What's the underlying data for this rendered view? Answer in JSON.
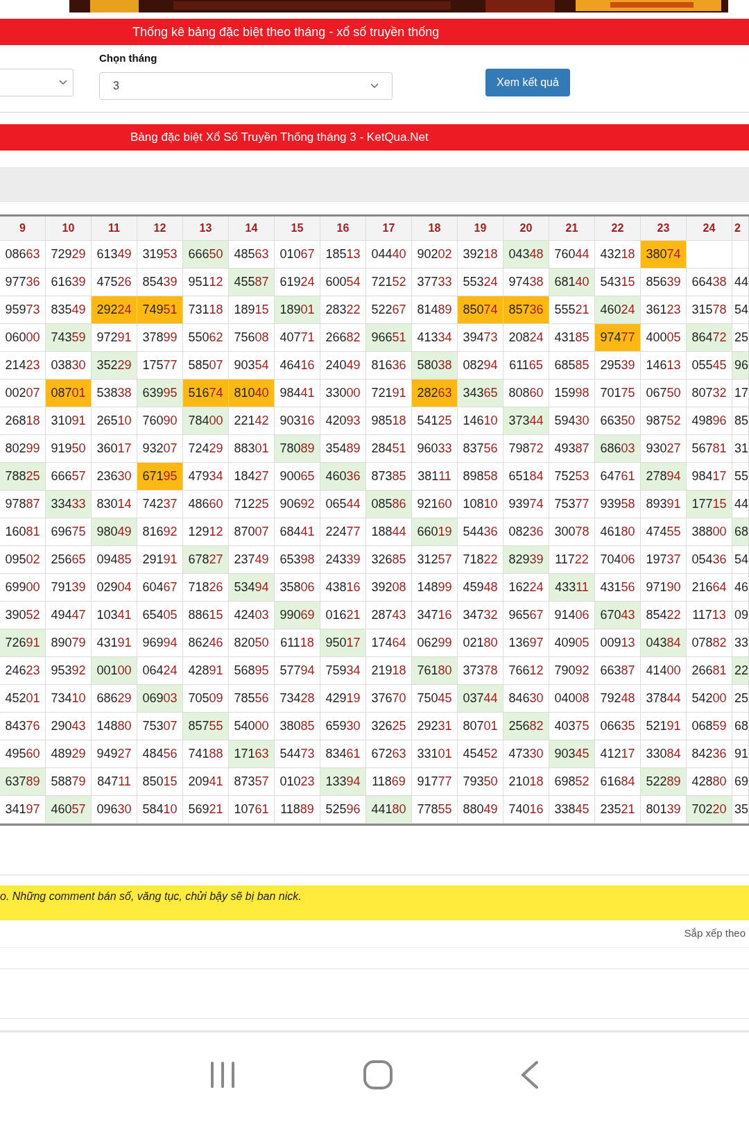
{
  "stats_bar": {
    "title": "Thống kê bảng đặc biệt theo tháng - xổ số truyền thống"
  },
  "filters": {
    "month_label": "Chọn tháng",
    "month_value": "3",
    "submit": "Xem kết quả"
  },
  "table_bar": {
    "title": "Bảng đặc biệt Xổ Số Truyền Thống tháng 3 - KetQua.Net"
  },
  "table": {
    "columns": [
      "9",
      "10",
      "11",
      "12",
      "13",
      "14",
      "15",
      "16",
      "17",
      "18",
      "19",
      "20",
      "21",
      "22",
      "23",
      "24",
      "2"
    ],
    "rows": [
      [
        {
          "text": "08663",
          "color": "#ffffff"
        },
        {
          "text": "72929",
          "color": "#ffffff"
        },
        {
          "text": "61349",
          "color": "#ffffff"
        },
        {
          "text": "31953",
          "color": "#ffffff"
        },
        {
          "text": "66650",
          "color": "#e2f2dc"
        },
        {
          "text": "48563",
          "color": "#ffffff"
        },
        {
          "text": "01067",
          "color": "#ffffff"
        },
        {
          "text": "18513",
          "color": "#ffffff"
        },
        {
          "text": "04440",
          "color": "#ffffff"
        },
        {
          "text": "90202",
          "color": "#ffffff"
        },
        {
          "text": "39218",
          "color": "#ffffff"
        },
        {
          "text": "04348",
          "color": "#e2f2dc"
        },
        {
          "text": "76044",
          "color": "#ffffff"
        },
        {
          "text": "43218",
          "color": "#ffffff"
        },
        {
          "text": "38074",
          "color": "#fdb813"
        }
      ],
      [
        {
          "text": "97736",
          "color": "#ffffff"
        },
        {
          "text": "61639",
          "color": "#ffffff"
        },
        {
          "text": "47526",
          "color": "#ffffff"
        },
        {
          "text": "85439",
          "color": "#ffffff"
        },
        {
          "text": "95112",
          "color": "#ffffff"
        },
        {
          "text": "45587",
          "color": "#e2f2dc"
        },
        {
          "text": "61924",
          "color": "#ffffff"
        },
        {
          "text": "60054",
          "color": "#ffffff"
        },
        {
          "text": "72152",
          "color": "#ffffff"
        },
        {
          "text": "37733",
          "color": "#ffffff"
        },
        {
          "text": "55324",
          "color": "#ffffff"
        },
        {
          "text": "97438",
          "color": "#ffffff"
        },
        {
          "text": "68140",
          "color": "#e2f2dc"
        },
        {
          "text": "54315",
          "color": "#ffffff"
        },
        {
          "text": "85639",
          "color": "#ffffff"
        },
        {
          "text": "66438",
          "color": "#ffffff"
        },
        {
          "text": "44",
          "color": "#ffffff"
        }
      ],
      [
        {
          "text": "95973",
          "color": "#ffffff"
        },
        {
          "text": "83549",
          "color": "#ffffff"
        },
        {
          "text": "29224",
          "color": "#fdb813"
        },
        {
          "text": "74951",
          "color": "#fdb813"
        },
        {
          "text": "73118",
          "color": "#ffffff"
        },
        {
          "text": "18915",
          "color": "#ffffff"
        },
        {
          "text": "18901",
          "color": "#e2f2dc"
        },
        {
          "text": "28322",
          "color": "#ffffff"
        },
        {
          "text": "52267",
          "color": "#ffffff"
        },
        {
          "text": "81489",
          "color": "#ffffff"
        },
        {
          "text": "85074",
          "color": "#fdb813"
        },
        {
          "text": "85736",
          "color": "#fdb813"
        },
        {
          "text": "55521",
          "color": "#ffffff"
        },
        {
          "text": "46024",
          "color": "#e2f2dc"
        },
        {
          "text": "36123",
          "color": "#ffffff"
        },
        {
          "text": "31578",
          "color": "#ffffff"
        },
        {
          "text": "54",
          "color": "#ffffff"
        }
      ],
      [
        {
          "text": "06000",
          "color": "#ffffff"
        },
        {
          "text": "74359",
          "color": "#e2f2dc"
        },
        {
          "text": "97291",
          "color": "#ffffff"
        },
        {
          "text": "37899",
          "color": "#ffffff"
        },
        {
          "text": "55062",
          "color": "#ffffff"
        },
        {
          "text": "75608",
          "color": "#ffffff"
        },
        {
          "text": "40771",
          "color": "#ffffff"
        },
        {
          "text": "26682",
          "color": "#ffffff"
        },
        {
          "text": "96651",
          "color": "#e2f2dc"
        },
        {
          "text": "41334",
          "color": "#ffffff"
        },
        {
          "text": "39473",
          "color": "#ffffff"
        },
        {
          "text": "20824",
          "color": "#ffffff"
        },
        {
          "text": "43185",
          "color": "#ffffff"
        },
        {
          "text": "97477",
          "color": "#fdb813"
        },
        {
          "text": "40005",
          "color": "#ffffff"
        },
        {
          "text": "86472",
          "color": "#e2f2dc"
        },
        {
          "text": "25",
          "color": "#ffffff"
        }
      ],
      [
        {
          "text": "21423",
          "color": "#ffffff"
        },
        {
          "text": "03830",
          "color": "#ffffff"
        },
        {
          "text": "35229",
          "color": "#e2f2dc"
        },
        {
          "text": "17577",
          "color": "#ffffff"
        },
        {
          "text": "58507",
          "color": "#ffffff"
        },
        {
          "text": "90354",
          "color": "#ffffff"
        },
        {
          "text": "46416",
          "color": "#ffffff"
        },
        {
          "text": "24049",
          "color": "#ffffff"
        },
        {
          "text": "81636",
          "color": "#ffffff"
        },
        {
          "text": "58038",
          "color": "#e2f2dc"
        },
        {
          "text": "08294",
          "color": "#ffffff"
        },
        {
          "text": "61165",
          "color": "#ffffff"
        },
        {
          "text": "68585",
          "color": "#ffffff"
        },
        {
          "text": "29539",
          "color": "#ffffff"
        },
        {
          "text": "14613",
          "color": "#ffffff"
        },
        {
          "text": "05545",
          "color": "#ffffff"
        },
        {
          "text": "96",
          "color": "#e2f2dc"
        }
      ],
      [
        {
          "text": "00207",
          "color": "#ffffff"
        },
        {
          "text": "08701",
          "color": "#fdb813"
        },
        {
          "text": "53838",
          "color": "#ffffff"
        },
        {
          "text": "63995",
          "color": "#e2f2dc"
        },
        {
          "text": "51674",
          "color": "#fdb813"
        },
        {
          "text": "81040",
          "color": "#fdb813"
        },
        {
          "text": "98441",
          "color": "#ffffff"
        },
        {
          "text": "33000",
          "color": "#ffffff"
        },
        {
          "text": "72191",
          "color": "#ffffff"
        },
        {
          "text": "28263",
          "color": "#fdb813"
        },
        {
          "text": "34365",
          "color": "#e2f2dc"
        },
        {
          "text": "80860",
          "color": "#ffffff"
        },
        {
          "text": "15998",
          "color": "#ffffff"
        },
        {
          "text": "70175",
          "color": "#ffffff"
        },
        {
          "text": "06750",
          "color": "#ffffff"
        },
        {
          "text": "80732",
          "color": "#ffffff"
        },
        {
          "text": "17",
          "color": "#ffffff"
        }
      ],
      [
        {
          "text": "26818",
          "color": "#ffffff"
        },
        {
          "text": "31091",
          "color": "#ffffff"
        },
        {
          "text": "26510",
          "color": "#ffffff"
        },
        {
          "text": "76090",
          "color": "#ffffff"
        },
        {
          "text": "78400",
          "color": "#e2f2dc"
        },
        {
          "text": "22142",
          "color": "#ffffff"
        },
        {
          "text": "90316",
          "color": "#ffffff"
        },
        {
          "text": "42093",
          "color": "#ffffff"
        },
        {
          "text": "98518",
          "color": "#ffffff"
        },
        {
          "text": "54125",
          "color": "#ffffff"
        },
        {
          "text": "14610",
          "color": "#ffffff"
        },
        {
          "text": "37344",
          "color": "#e2f2dc"
        },
        {
          "text": "59430",
          "color": "#ffffff"
        },
        {
          "text": "66350",
          "color": "#ffffff"
        },
        {
          "text": "98752",
          "color": "#ffffff"
        },
        {
          "text": "49896",
          "color": "#ffffff"
        },
        {
          "text": "85",
          "color": "#ffffff"
        }
      ],
      [
        {
          "text": "80299",
          "color": "#ffffff"
        },
        {
          "text": "91950",
          "color": "#ffffff"
        },
        {
          "text": "36017",
          "color": "#ffffff"
        },
        {
          "text": "93207",
          "color": "#ffffff"
        },
        {
          "text": "72429",
          "color": "#ffffff"
        },
        {
          "text": "88301",
          "color": "#ffffff"
        },
        {
          "text": "78089",
          "color": "#e2f2dc"
        },
        {
          "text": "35489",
          "color": "#ffffff"
        },
        {
          "text": "28451",
          "color": "#ffffff"
        },
        {
          "text": "96033",
          "color": "#ffffff"
        },
        {
          "text": "83756",
          "color": "#ffffff"
        },
        {
          "text": "79872",
          "color": "#ffffff"
        },
        {
          "text": "49387",
          "color": "#ffffff"
        },
        {
          "text": "68603",
          "color": "#e2f2dc"
        },
        {
          "text": "93027",
          "color": "#ffffff"
        },
        {
          "text": "56781",
          "color": "#ffffff"
        },
        {
          "text": "31",
          "color": "#ffffff"
        }
      ],
      [
        {
          "text": "78825",
          "color": "#e2f2dc"
        },
        {
          "text": "66657",
          "color": "#ffffff"
        },
        {
          "text": "23630",
          "color": "#ffffff"
        },
        {
          "text": "67195",
          "color": "#fdb813"
        },
        {
          "text": "47934",
          "color": "#ffffff"
        },
        {
          "text": "18427",
          "color": "#ffffff"
        },
        {
          "text": "90065",
          "color": "#ffffff"
        },
        {
          "text": "46036",
          "color": "#e2f2dc"
        },
        {
          "text": "87385",
          "color": "#ffffff"
        },
        {
          "text": "38111",
          "color": "#ffffff"
        },
        {
          "text": "89858",
          "color": "#ffffff"
        },
        {
          "text": "65184",
          "color": "#ffffff"
        },
        {
          "text": "75253",
          "color": "#ffffff"
        },
        {
          "text": "64761",
          "color": "#ffffff"
        },
        {
          "text": "27894",
          "color": "#e2f2dc"
        },
        {
          "text": "98417",
          "color": "#ffffff"
        },
        {
          "text": "55",
          "color": "#ffffff"
        }
      ],
      [
        {
          "text": "97887",
          "color": "#ffffff"
        },
        {
          "text": "33433",
          "color": "#e2f2dc"
        },
        {
          "text": "83014",
          "color": "#ffffff"
        },
        {
          "text": "74237",
          "color": "#ffffff"
        },
        {
          "text": "48660",
          "color": "#ffffff"
        },
        {
          "text": "71225",
          "color": "#ffffff"
        },
        {
          "text": "90692",
          "color": "#ffffff"
        },
        {
          "text": "06544",
          "color": "#ffffff"
        },
        {
          "text": "08586",
          "color": "#e2f2dc"
        },
        {
          "text": "92160",
          "color": "#ffffff"
        },
        {
          "text": "10810",
          "color": "#ffffff"
        },
        {
          "text": "93974",
          "color": "#ffffff"
        },
        {
          "text": "75377",
          "color": "#ffffff"
        },
        {
          "text": "93958",
          "color": "#ffffff"
        },
        {
          "text": "89391",
          "color": "#ffffff"
        },
        {
          "text": "17715",
          "color": "#e2f2dc"
        },
        {
          "text": "44",
          "color": "#ffffff"
        }
      ],
      [
        {
          "text": "16081",
          "color": "#ffffff"
        },
        {
          "text": "69675",
          "color": "#ffffff"
        },
        {
          "text": "98049",
          "color": "#e2f2dc"
        },
        {
          "text": "81692",
          "color": "#ffffff"
        },
        {
          "text": "12912",
          "color": "#ffffff"
        },
        {
          "text": "87007",
          "color": "#ffffff"
        },
        {
          "text": "68441",
          "color": "#ffffff"
        },
        {
          "text": "22477",
          "color": "#ffffff"
        },
        {
          "text": "18844",
          "color": "#ffffff"
        },
        {
          "text": "66019",
          "color": "#e2f2dc"
        },
        {
          "text": "54436",
          "color": "#ffffff"
        },
        {
          "text": "08236",
          "color": "#ffffff"
        },
        {
          "text": "30078",
          "color": "#ffffff"
        },
        {
          "text": "46180",
          "color": "#ffffff"
        },
        {
          "text": "47455",
          "color": "#ffffff"
        },
        {
          "text": "38800",
          "color": "#ffffff"
        },
        {
          "text": "68",
          "color": "#e2f2dc"
        }
      ],
      [
        {
          "text": "09502",
          "color": "#ffffff"
        },
        {
          "text": "25665",
          "color": "#ffffff"
        },
        {
          "text": "09485",
          "color": "#ffffff"
        },
        {
          "text": "29191",
          "color": "#ffffff"
        },
        {
          "text": "67827",
          "color": "#e2f2dc"
        },
        {
          "text": "23749",
          "color": "#ffffff"
        },
        {
          "text": "65398",
          "color": "#ffffff"
        },
        {
          "text": "24339",
          "color": "#ffffff"
        },
        {
          "text": "32685",
          "color": "#ffffff"
        },
        {
          "text": "31257",
          "color": "#ffffff"
        },
        {
          "text": "71822",
          "color": "#ffffff"
        },
        {
          "text": "82939",
          "color": "#e2f2dc"
        },
        {
          "text": "11722",
          "color": "#ffffff"
        },
        {
          "text": "70406",
          "color": "#ffffff"
        },
        {
          "text": "19737",
          "color": "#ffffff"
        },
        {
          "text": "05436",
          "color": "#ffffff"
        },
        {
          "text": "54",
          "color": "#ffffff"
        }
      ],
      [
        {
          "text": "69900",
          "color": "#ffffff"
        },
        {
          "text": "79139",
          "color": "#ffffff"
        },
        {
          "text": "02904",
          "color": "#ffffff"
        },
        {
          "text": "60467",
          "color": "#ffffff"
        },
        {
          "text": "71826",
          "color": "#ffffff"
        },
        {
          "text": "53494",
          "color": "#e2f2dc"
        },
        {
          "text": "35806",
          "color": "#ffffff"
        },
        {
          "text": "43816",
          "color": "#ffffff"
        },
        {
          "text": "39208",
          "color": "#ffffff"
        },
        {
          "text": "14899",
          "color": "#ffffff"
        },
        {
          "text": "45948",
          "color": "#ffffff"
        },
        {
          "text": "16224",
          "color": "#ffffff"
        },
        {
          "text": "43311",
          "color": "#e2f2dc"
        },
        {
          "text": "43156",
          "color": "#ffffff"
        },
        {
          "text": "97190",
          "color": "#ffffff"
        },
        {
          "text": "21664",
          "color": "#ffffff"
        },
        {
          "text": "46",
          "color": "#ffffff"
        }
      ],
      [
        {
          "text": "39052",
          "color": "#ffffff"
        },
        {
          "text": "49447",
          "color": "#ffffff"
        },
        {
          "text": "10341",
          "color": "#ffffff"
        },
        {
          "text": "65405",
          "color": "#ffffff"
        },
        {
          "text": "88615",
          "color": "#ffffff"
        },
        {
          "text": "42403",
          "color": "#ffffff"
        },
        {
          "text": "99069",
          "color": "#e2f2dc"
        },
        {
          "text": "01621",
          "color": "#ffffff"
        },
        {
          "text": "28743",
          "color": "#ffffff"
        },
        {
          "text": "34716",
          "color": "#ffffff"
        },
        {
          "text": "34732",
          "color": "#ffffff"
        },
        {
          "text": "96567",
          "color": "#ffffff"
        },
        {
          "text": "91406",
          "color": "#ffffff"
        },
        {
          "text": "67043",
          "color": "#e2f2dc"
        },
        {
          "text": "85422",
          "color": "#ffffff"
        },
        {
          "text": "11713",
          "color": "#ffffff"
        },
        {
          "text": "09",
          "color": "#ffffff"
        }
      ],
      [
        {
          "text": "72691",
          "color": "#e2f2dc"
        },
        {
          "text": "89079",
          "color": "#ffffff"
        },
        {
          "text": "43191",
          "color": "#ffffff"
        },
        {
          "text": "96994",
          "color": "#ffffff"
        },
        {
          "text": "86246",
          "color": "#ffffff"
        },
        {
          "text": "82050",
          "color": "#ffffff"
        },
        {
          "text": "61118",
          "color": "#ffffff"
        },
        {
          "text": "95017",
          "color": "#e2f2dc"
        },
        {
          "text": "17464",
          "color": "#ffffff"
        },
        {
          "text": "06299",
          "color": "#ffffff"
        },
        {
          "text": "02180",
          "color": "#ffffff"
        },
        {
          "text": "13697",
          "color": "#ffffff"
        },
        {
          "text": "40905",
          "color": "#ffffff"
        },
        {
          "text": "00913",
          "color": "#ffffff"
        },
        {
          "text": "04384",
          "color": "#e2f2dc"
        },
        {
          "text": "07882",
          "color": "#ffffff"
        },
        {
          "text": "33",
          "color": "#ffffff"
        }
      ],
      [
        {
          "text": "24623",
          "color": "#ffffff"
        },
        {
          "text": "95392",
          "color": "#ffffff"
        },
        {
          "text": "00100",
          "color": "#e2f2dc"
        },
        {
          "text": "06424",
          "color": "#ffffff"
        },
        {
          "text": "42891",
          "color": "#ffffff"
        },
        {
          "text": "56895",
          "color": "#ffffff"
        },
        {
          "text": "57794",
          "color": "#ffffff"
        },
        {
          "text": "75934",
          "color": "#ffffff"
        },
        {
          "text": "21918",
          "color": "#ffffff"
        },
        {
          "text": "76180",
          "color": "#e2f2dc"
        },
        {
          "text": "37378",
          "color": "#ffffff"
        },
        {
          "text": "76612",
          "color": "#ffffff"
        },
        {
          "text": "79092",
          "color": "#ffffff"
        },
        {
          "text": "66387",
          "color": "#ffffff"
        },
        {
          "text": "41400",
          "color": "#ffffff"
        },
        {
          "text": "26681",
          "color": "#ffffff"
        },
        {
          "text": "22",
          "color": "#e2f2dc"
        }
      ],
      [
        {
          "text": "45201",
          "color": "#ffffff"
        },
        {
          "text": "73410",
          "color": "#ffffff"
        },
        {
          "text": "68629",
          "color": "#ffffff"
        },
        {
          "text": "06903",
          "color": "#e2f2dc"
        },
        {
          "text": "70509",
          "color": "#ffffff"
        },
        {
          "text": "78556",
          "color": "#ffffff"
        },
        {
          "text": "73428",
          "color": "#ffffff"
        },
        {
          "text": "42919",
          "color": "#ffffff"
        },
        {
          "text": "37670",
          "color": "#ffffff"
        },
        {
          "text": "75045",
          "color": "#ffffff"
        },
        {
          "text": "03744",
          "color": "#e2f2dc"
        },
        {
          "text": "84630",
          "color": "#ffffff"
        },
        {
          "text": "04008",
          "color": "#ffffff"
        },
        {
          "text": "79248",
          "color": "#ffffff"
        },
        {
          "text": "37844",
          "color": "#ffffff"
        },
        {
          "text": "54200",
          "color": "#ffffff"
        },
        {
          "text": "25",
          "color": "#ffffff"
        }
      ],
      [
        {
          "text": "84376",
          "color": "#ffffff"
        },
        {
          "text": "29043",
          "color": "#ffffff"
        },
        {
          "text": "14880",
          "color": "#ffffff"
        },
        {
          "text": "75307",
          "color": "#ffffff"
        },
        {
          "text": "85755",
          "color": "#e2f2dc"
        },
        {
          "text": "54000",
          "color": "#ffffff"
        },
        {
          "text": "38085",
          "color": "#ffffff"
        },
        {
          "text": "65930",
          "color": "#ffffff"
        },
        {
          "text": "32625",
          "color": "#ffffff"
        },
        {
          "text": "29231",
          "color": "#ffffff"
        },
        {
          "text": "80701",
          "color": "#ffffff"
        },
        {
          "text": "25682",
          "color": "#e2f2dc"
        },
        {
          "text": "40375",
          "color": "#ffffff"
        },
        {
          "text": "06635",
          "color": "#ffffff"
        },
        {
          "text": "52191",
          "color": "#ffffff"
        },
        {
          "text": "06859",
          "color": "#ffffff"
        },
        {
          "text": "68",
          "color": "#ffffff"
        }
      ],
      [
        {
          "text": "49560",
          "color": "#ffffff"
        },
        {
          "text": "48929",
          "color": "#ffffff"
        },
        {
          "text": "94927",
          "color": "#ffffff"
        },
        {
          "text": "48456",
          "color": "#ffffff"
        },
        {
          "text": "74188",
          "color": "#ffffff"
        },
        {
          "text": "17163",
          "color": "#e2f2dc"
        },
        {
          "text": "54473",
          "color": "#ffffff"
        },
        {
          "text": "83461",
          "color": "#ffffff"
        },
        {
          "text": "67263",
          "color": "#ffffff"
        },
        {
          "text": "33101",
          "color": "#ffffff"
        },
        {
          "text": "45452",
          "color": "#ffffff"
        },
        {
          "text": "47330",
          "color": "#ffffff"
        },
        {
          "text": "90345",
          "color": "#e2f2dc"
        },
        {
          "text": "41217",
          "color": "#ffffff"
        },
        {
          "text": "33084",
          "color": "#ffffff"
        },
        {
          "text": "84236",
          "color": "#ffffff"
        },
        {
          "text": "91",
          "color": "#ffffff"
        }
      ],
      [
        {
          "text": "63789",
          "color": "#e2f2dc"
        },
        {
          "text": "58879",
          "color": "#ffffff"
        },
        {
          "text": "84711",
          "color": "#ffffff"
        },
        {
          "text": "85015",
          "color": "#ffffff"
        },
        {
          "text": "20941",
          "color": "#ffffff"
        },
        {
          "text": "87357",
          "color": "#ffffff"
        },
        {
          "text": "01023",
          "color": "#ffffff"
        },
        {
          "text": "13394",
          "color": "#e2f2dc"
        },
        {
          "text": "11869",
          "color": "#ffffff"
        },
        {
          "text": "91777",
          "color": "#ffffff"
        },
        {
          "text": "79350",
          "color": "#ffffff"
        },
        {
          "text": "21018",
          "color": "#ffffff"
        },
        {
          "text": "69852",
          "color": "#ffffff"
        },
        {
          "text": "61684",
          "color": "#ffffff"
        },
        {
          "text": "52289",
          "color": "#e2f2dc"
        },
        {
          "text": "42880",
          "color": "#ffffff"
        },
        {
          "text": "69",
          "color": "#ffffff"
        }
      ],
      [
        {
          "text": "34197",
          "color": "#ffffff"
        },
        {
          "text": "46057",
          "color": "#e2f2dc"
        },
        {
          "text": "09630",
          "color": "#ffffff"
        },
        {
          "text": "58410",
          "color": "#ffffff"
        },
        {
          "text": "56921",
          "color": "#ffffff"
        },
        {
          "text": "10761",
          "color": "#ffffff"
        },
        {
          "text": "11889",
          "color": "#ffffff"
        },
        {
          "text": "52596",
          "color": "#ffffff"
        },
        {
          "text": "44180",
          "color": "#e2f2dc"
        },
        {
          "text": "77855",
          "color": "#ffffff"
        },
        {
          "text": "88049",
          "color": "#ffffff"
        },
        {
          "text": "74016",
          "color": "#ffffff"
        },
        {
          "text": "33845",
          "color": "#ffffff"
        },
        {
          "text": "23521",
          "color": "#ffffff"
        },
        {
          "text": "80139",
          "color": "#ffffff"
        },
        {
          "text": "70220",
          "color": "#e2f2dc"
        },
        {
          "text": "35",
          "color": "#ffffff"
        }
      ]
    ]
  },
  "notice": {
    "text": "o. Những comment bán số, văng tục, chửi bậy sẽ bị ban nick."
  },
  "sort": {
    "label": "Sắp xếp theo"
  }
}
